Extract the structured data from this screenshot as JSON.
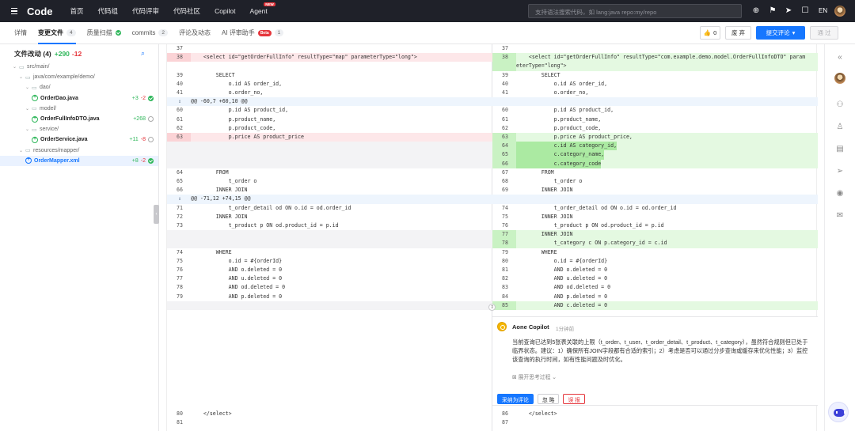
{
  "topnav": {
    "logo": "Code",
    "items": [
      "首页",
      "代码组",
      "代码评审",
      "代码社区",
      "Copilot",
      "Agent"
    ],
    "new_badge": "NEW",
    "search_placeholder": "支持语法搜索代码，如 lang:java repo:my/repo",
    "lang": "EN"
  },
  "tabs": {
    "detail": "详情",
    "files": "变更文件",
    "files_count": "4",
    "scan": "质量扫描",
    "commits": "commits",
    "commits_count": "2",
    "comments": "评论及动态",
    "ai": "AI 评审助手",
    "ai_beta": "Beta",
    "ai_count": "1"
  },
  "actions": {
    "like_count": "0",
    "abandon": "废 弃",
    "submit": "提交评论",
    "approve": "通 过"
  },
  "sidebar": {
    "title": "文件改动 (4)",
    "plus": "+290",
    "minus": "-12",
    "tree": [
      {
        "label": "src/main/",
        "kind": "folder",
        "indent": 0
      },
      {
        "label": "java/com/example/demo/",
        "kind": "folder",
        "indent": 1
      },
      {
        "label": "dao/",
        "kind": "folder",
        "indent": 2
      },
      {
        "label": "OrderDao.java",
        "kind": "file",
        "indent": 3,
        "plus": "+3",
        "minus": "-2",
        "status": "ok"
      },
      {
        "label": "model/",
        "kind": "folder",
        "indent": 2
      },
      {
        "label": "OrderFullInfoDTO.java",
        "kind": "file",
        "indent": 3,
        "plus": "+268",
        "minus": "",
        "status": "pending"
      },
      {
        "label": "service/",
        "kind": "folder",
        "indent": 2
      },
      {
        "label": "OrderService.java",
        "kind": "file",
        "indent": 3,
        "plus": "+11",
        "minus": "-8",
        "status": "pending"
      },
      {
        "label": "resources/mapper/",
        "kind": "folder",
        "indent": 1
      },
      {
        "label": "OrderMapper.xml",
        "kind": "file",
        "indent": 2,
        "plus": "+8",
        "minus": "-2",
        "status": "ok",
        "selected": true
      }
    ]
  },
  "diff": {
    "left": [
      {
        "ln": "37",
        "code": "",
        "t": "ctx"
      },
      {
        "ln": "38",
        "code": "    <select id=\"getOrderFullInfo\" resultType=\"map\" parameterType=\"long\">",
        "t": "del"
      },
      {
        "ln": "39",
        "code": "        SELECT",
        "t": "ctx"
      },
      {
        "ln": "40",
        "code": "            o.id AS order_id,",
        "t": "ctx"
      },
      {
        "ln": "41",
        "code": "            o.order_no,",
        "t": "ctx"
      },
      {
        "ln": "",
        "code": "@@ -60,7 +60,10 @@",
        "t": "hunk"
      },
      {
        "ln": "60",
        "code": "            p.id AS product_id,",
        "t": "ctx"
      },
      {
        "ln": "61",
        "code": "            p.product_name,",
        "t": "ctx"
      },
      {
        "ln": "62",
        "code": "            p.product_code,",
        "t": "ctx"
      },
      {
        "ln": "63",
        "code": "            p.price AS product_price",
        "t": "del"
      },
      {
        "ln": "",
        "code": "",
        "t": "blank"
      },
      {
        "ln": "",
        "code": "",
        "t": "blank"
      },
      {
        "ln": "",
        "code": "",
        "t": "blank"
      },
      {
        "ln": "64",
        "code": "        FROM",
        "t": "ctx"
      },
      {
        "ln": "65",
        "code": "            t_order o",
        "t": "ctx"
      },
      {
        "ln": "66",
        "code": "        INNER JOIN",
        "t": "ctx"
      },
      {
        "ln": "",
        "code": "@@ -71,12 +74,15 @@",
        "t": "hunk"
      },
      {
        "ln": "71",
        "code": "            t_order_detail od ON o.id = od.order_id",
        "t": "ctx"
      },
      {
        "ln": "72",
        "code": "        INNER JOIN",
        "t": "ctx"
      },
      {
        "ln": "73",
        "code": "            t_product p ON od.product_id = p.id",
        "t": "ctx"
      },
      {
        "ln": "",
        "code": "",
        "t": "blank"
      },
      {
        "ln": "",
        "code": "",
        "t": "blank"
      },
      {
        "ln": "74",
        "code": "        WHERE",
        "t": "ctx"
      },
      {
        "ln": "75",
        "code": "            o.id = #{orderId}",
        "t": "ctx"
      },
      {
        "ln": "76",
        "code": "            AND o.deleted = 0",
        "t": "ctx"
      },
      {
        "ln": "77",
        "code": "            AND u.deleted = 0",
        "t": "ctx"
      },
      {
        "ln": "78",
        "code": "            AND od.deleted = 0",
        "t": "ctx"
      },
      {
        "ln": "79",
        "code": "            AND p.deleted = 0",
        "t": "ctx"
      },
      {
        "ln": "",
        "code": "",
        "t": "blank"
      }
    ],
    "right": [
      {
        "ln": "37",
        "code": "",
        "t": "ctx"
      },
      {
        "ln": "38",
        "code": "    <select id=\"getOrderFullInfo\" resultType=\"com.example.demo.model.OrderFullInfoDTO\" param",
        "code2": "eterType=\"long\">",
        "t": "add"
      },
      {
        "ln": "39",
        "code": "        SELECT",
        "t": "ctx"
      },
      {
        "ln": "40",
        "code": "            o.id AS order_id,",
        "t": "ctx"
      },
      {
        "ln": "41",
        "code": "            o.order_no,",
        "t": "ctx"
      },
      {
        "ln": "",
        "code": "",
        "t": "hunk"
      },
      {
        "ln": "60",
        "code": "            p.id AS product_id,",
        "t": "ctx"
      },
      {
        "ln": "61",
        "code": "            p.product_name,",
        "t": "ctx"
      },
      {
        "ln": "62",
        "code": "            p.product_code,",
        "t": "ctx"
      },
      {
        "ln": "63",
        "code": "            p.price AS product_price,",
        "t": "add"
      },
      {
        "ln": "64",
        "code": "            c.id AS category_id,",
        "t": "add",
        "hl": true
      },
      {
        "ln": "65",
        "code": "            c.category_name,",
        "t": "add",
        "hl": true
      },
      {
        "ln": "66",
        "code": "            c.category_code",
        "t": "add",
        "hl": true
      },
      {
        "ln": "67",
        "code": "        FROM",
        "t": "ctx"
      },
      {
        "ln": "68",
        "code": "            t_order o",
        "t": "ctx"
      },
      {
        "ln": "69",
        "code": "        INNER JOIN",
        "t": "ctx"
      },
      {
        "ln": "",
        "code": "",
        "t": "hunk"
      },
      {
        "ln": "74",
        "code": "            t_order_detail od ON o.id = od.order_id",
        "t": "ctx"
      },
      {
        "ln": "75",
        "code": "        INNER JOIN",
        "t": "ctx"
      },
      {
        "ln": "76",
        "code": "            t_product p ON od.product_id = p.id",
        "t": "ctx"
      },
      {
        "ln": "77",
        "code": "        INNER JOIN",
        "t": "add"
      },
      {
        "ln": "78",
        "code": "            t_category c ON p.category_id = c.id",
        "t": "add"
      },
      {
        "ln": "79",
        "code": "        WHERE",
        "t": "ctx"
      },
      {
        "ln": "80",
        "code": "            o.id = #{orderId}",
        "t": "ctx"
      },
      {
        "ln": "81",
        "code": "            AND o.deleted = 0",
        "t": "ctx"
      },
      {
        "ln": "82",
        "code": "            AND u.deleted = 0",
        "t": "ctx"
      },
      {
        "ln": "83",
        "code": "            AND od.deleted = 0",
        "t": "ctx"
      },
      {
        "ln": "84",
        "code": "            AND p.deleted = 0",
        "t": "ctx"
      },
      {
        "ln": "85",
        "code": "            AND c.deleted = 0",
        "t": "add"
      }
    ],
    "tail_left": [
      {
        "ln": "80",
        "code": "    </select>"
      },
      {
        "ln": "81",
        "code": ""
      }
    ],
    "tail_right": [
      {
        "ln": "86",
        "code": "    </select>"
      },
      {
        "ln": "87",
        "code": ""
      }
    ]
  },
  "comment": {
    "author": "Aone Copilot",
    "time": "1分钟前",
    "body": "当前查询已达到5张表关联的上限（t_order、t_user、t_order_detail、t_product、t_category），虽然符合规则但已处于临界状态。建议：1）确保所有JOIN字段都有合适的索引；2）考虑是否可以通过分步查询或缓存来优化性能；3）监控该查询的执行时间，如有性能问题及时优化。",
    "expand": "展开思考过程",
    "adopt": "采纳为评论",
    "ignore": "忽 略",
    "report": "误 报"
  },
  "colors": {
    "accent": "#1677ff",
    "add_bg": "#e4f9e1",
    "del_bg": "#fde7e9",
    "nav_bg": "#1f2129"
  }
}
